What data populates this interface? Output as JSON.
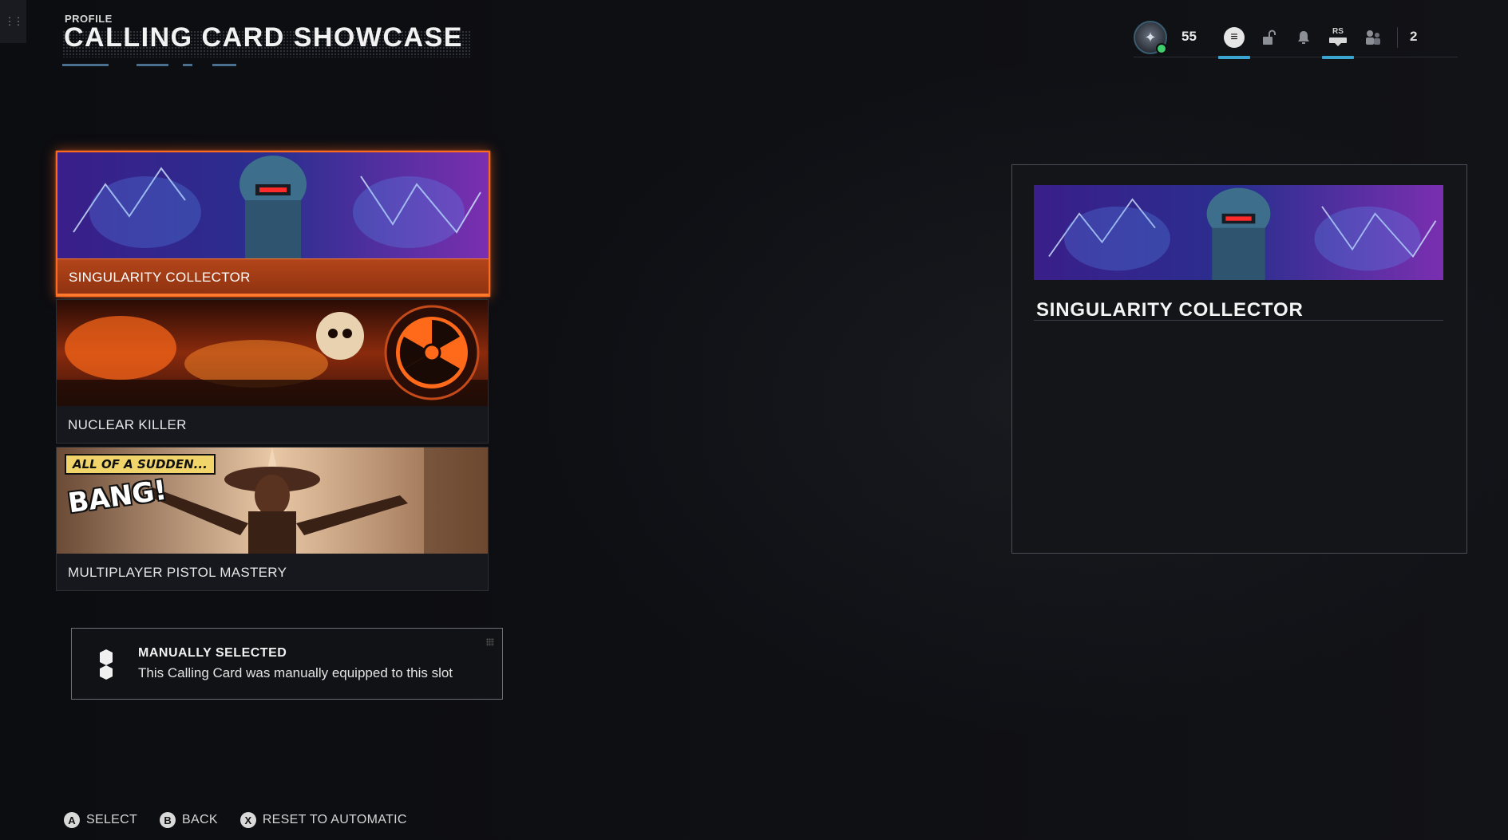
{
  "header": {
    "eyebrow": "PROFILE",
    "title": "CALLING CARD SHOWCASE"
  },
  "topbar": {
    "level": "55",
    "notification_count": "2",
    "rs_hint": "RS",
    "icons": [
      "player-emblem-icon",
      "menu-icon",
      "lock-icon",
      "bell-icon",
      "rs-tab-icon",
      "friends-icon"
    ],
    "accent_color": "#3aa3cf"
  },
  "cards": [
    {
      "label": "SINGULARITY COLLECTOR",
      "selected": true
    },
    {
      "label": "NUCLEAR KILLER",
      "selected": false
    },
    {
      "label": "MULTIPLAYER PISTOL MASTERY",
      "selected": false,
      "art_caption": "ALL OF A SUDDEN...",
      "art_sfx": "BANG!"
    }
  ],
  "info": {
    "title": "MANUALLY SELECTED",
    "body": "This Calling Card was manually equipped to this slot"
  },
  "preview": {
    "name": "SINGULARITY COLLECTOR"
  },
  "footer": {
    "prompts": [
      {
        "button": "A",
        "label": "SELECT"
      },
      {
        "button": "B",
        "label": "BACK"
      },
      {
        "button": "X",
        "label": "RESET TO AUTOMATIC"
      }
    ]
  },
  "colors": {
    "selected_border": "#ff6a1f",
    "selected_strip": "#b3451a",
    "background": "#0d0e12"
  }
}
